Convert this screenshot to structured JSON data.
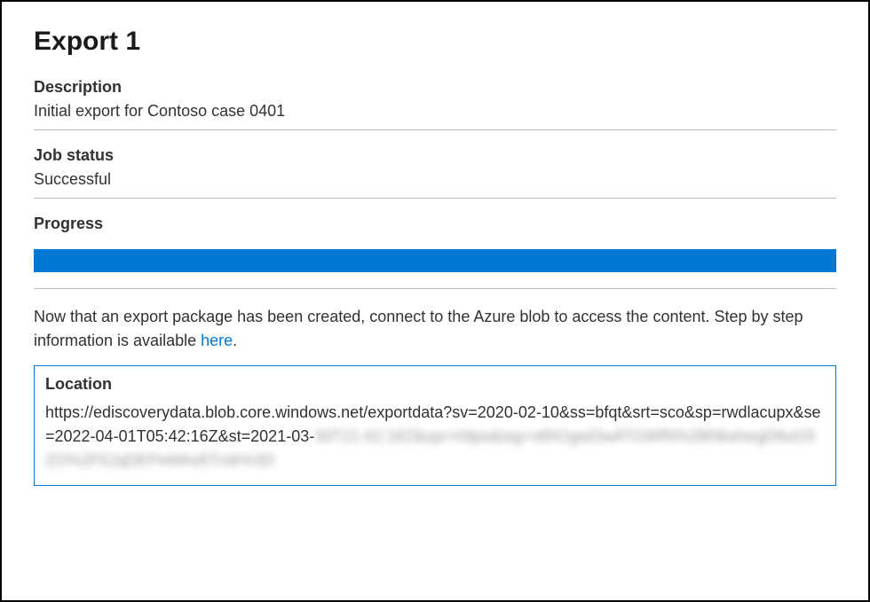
{
  "title": "Export 1",
  "description": {
    "label": "Description",
    "value": "Initial export for Contoso case 0401"
  },
  "job_status": {
    "label": "Job status",
    "value": "Successful"
  },
  "progress": {
    "label": "Progress",
    "percent": 100,
    "color": "#0078d4"
  },
  "info": {
    "text_before_link": "Now that an export package has been created, connect to the Azure blob to access the content. Step by step information is available ",
    "link_text": "here",
    "text_after_link": "."
  },
  "location": {
    "label": "Location",
    "url_visible": "https://ediscoverydata.blob.core.windows.net/exportdata?sv=2020-02-10&ss=bfqt&srt=sco&sp=rwdlacupx&se=2022-04-01T05:42:16Z&st=2021-03-",
    "url_redacted": "30T21:42:16Z&spr=https&sig=v6hOgwDwATGWfN%2BNkehegD9uG5ZO%2F0JqDEPeMAz6Tmk%3D"
  }
}
